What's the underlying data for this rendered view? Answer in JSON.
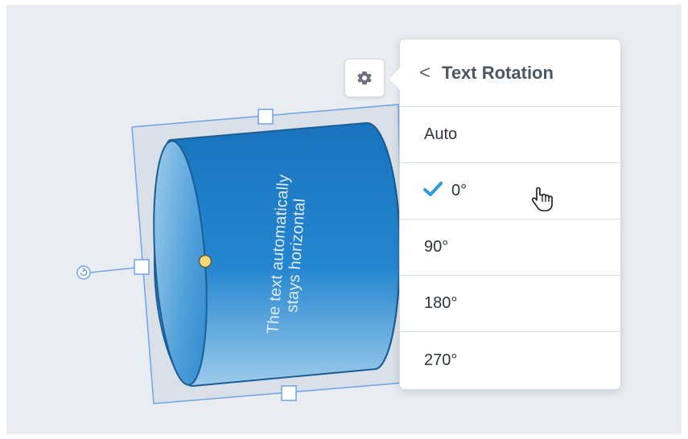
{
  "shape": {
    "text": "The text automatically stays horizontal",
    "fill_top": "#1a78c2",
    "fill_mid": "#2586d0",
    "fill_bottom": "#9ccbeb",
    "selection_color": "#6fa3ea"
  },
  "toolbar": {
    "settings_icon": "gear-icon"
  },
  "panel": {
    "back_icon": "chevron-left-icon",
    "back_glyph": "<",
    "title": "Text Rotation",
    "options": [
      {
        "label": "Auto",
        "selected": false
      },
      {
        "label": "0°",
        "selected": true
      },
      {
        "label": "90°",
        "selected": false
      },
      {
        "label": "180°",
        "selected": false
      },
      {
        "label": "270°",
        "selected": false
      }
    ],
    "check_color": "#2d9cdb"
  }
}
